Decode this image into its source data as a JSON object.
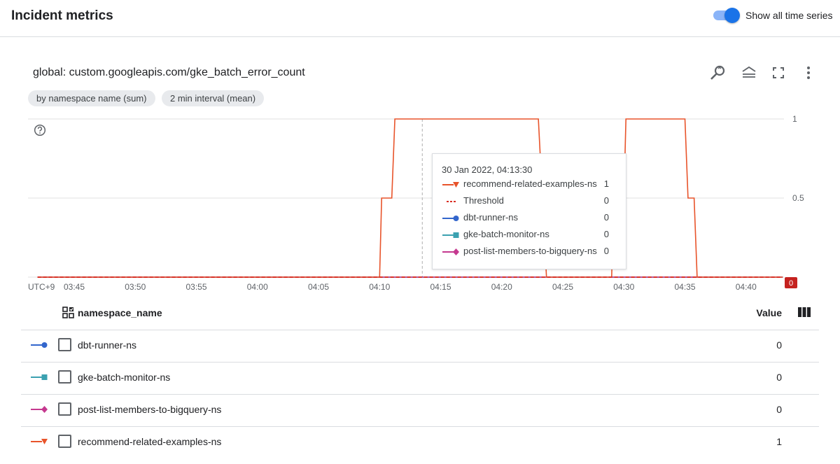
{
  "header": {
    "title": "Incident metrics",
    "toggle_label": "Show all time series",
    "toggle_on": true
  },
  "panel": {
    "title": "global: custom.googleapis.com/gke_batch_error_count",
    "chips": [
      "by namespace name (sum)",
      "2 min interval (mean)"
    ],
    "icons": [
      "zoom-icon",
      "legend-icon",
      "fullscreen-icon",
      "more-vert-icon"
    ]
  },
  "colors": {
    "recommend": "#e8542b",
    "threshold": "#d93025",
    "dbt": "#3366cc",
    "gke": "#3ba1b0",
    "post": "#c5398f",
    "grid": "#e0e0e0"
  },
  "chart_data": {
    "type": "line",
    "timezone_label": "UTC+9",
    "x_ticks": [
      "03:45",
      "03:50",
      "03:55",
      "04:00",
      "04:05",
      "04:10",
      "04:15",
      "04:20",
      "04:25",
      "04:30",
      "04:35",
      "04:40"
    ],
    "y_ticks": [
      "1",
      "0.5",
      "0"
    ],
    "ylim": [
      0,
      1
    ],
    "current_value_badge": "0",
    "cursor_time": "04:13:30",
    "series": [
      {
        "name": "recommend-related-examples-ns",
        "color_key": "recommend",
        "marker": "triangle-down",
        "points": [
          [
            "03:42",
            0
          ],
          [
            "04:10",
            0
          ],
          [
            "04:10:10",
            0.5
          ],
          [
            "04:11",
            0.5
          ],
          [
            "04:11:15",
            1
          ],
          [
            "04:23",
            1
          ],
          [
            "04:23:40",
            0
          ],
          [
            "04:29",
            0
          ],
          [
            "04:29:10",
            0.5
          ],
          [
            "04:30",
            0.5
          ],
          [
            "04:30:10",
            1
          ],
          [
            "04:35",
            1
          ],
          [
            "04:35:15",
            0.5
          ],
          [
            "04:35:45",
            0.5
          ],
          [
            "04:36",
            0
          ],
          [
            "04:43",
            0
          ]
        ]
      },
      {
        "name": "Threshold",
        "color_key": "threshold",
        "dashed": true,
        "points": [
          [
            "03:42",
            0
          ],
          [
            "04:43",
            0
          ]
        ]
      },
      {
        "name": "dbt-runner-ns",
        "color_key": "dbt",
        "marker": "circle",
        "points": [
          [
            "03:42",
            0
          ],
          [
            "04:43",
            0
          ]
        ]
      },
      {
        "name": "gke-batch-monitor-ns",
        "color_key": "gke",
        "marker": "square",
        "points": [
          [
            "03:42",
            0
          ],
          [
            "04:43",
            0
          ]
        ]
      },
      {
        "name": "post-list-members-to-bigquery-ns",
        "color_key": "post",
        "marker": "diamond",
        "points": [
          [
            "03:42",
            0
          ],
          [
            "04:43",
            0
          ]
        ]
      }
    ]
  },
  "tooltip": {
    "time": "30 Jan 2022, 04:13:30",
    "rows": [
      {
        "name": "recommend-related-examples-ns",
        "value": "1",
        "color_key": "recommend",
        "marker": "triangle-down"
      },
      {
        "name": "Threshold",
        "value": "0",
        "color_key": "threshold",
        "marker": "dash"
      },
      {
        "name": "dbt-runner-ns",
        "value": "0",
        "color_key": "dbt",
        "marker": "circle"
      },
      {
        "name": "gke-batch-monitor-ns",
        "value": "0",
        "color_key": "gke",
        "marker": "square"
      },
      {
        "name": "post-list-members-to-bigquery-ns",
        "value": "0",
        "color_key": "post",
        "marker": "diamond"
      }
    ]
  },
  "table": {
    "col_name": "namespace_name",
    "col_value": "Value",
    "rows": [
      {
        "name": "dbt-runner-ns",
        "value": "0",
        "color_key": "dbt",
        "marker": "circle"
      },
      {
        "name": "gke-batch-monitor-ns",
        "value": "0",
        "color_key": "gke",
        "marker": "square"
      },
      {
        "name": "post-list-members-to-bigquery-ns",
        "value": "0",
        "color_key": "post",
        "marker": "diamond"
      },
      {
        "name": "recommend-related-examples-ns",
        "value": "1",
        "color_key": "recommend",
        "marker": "triangle-down"
      }
    ]
  }
}
